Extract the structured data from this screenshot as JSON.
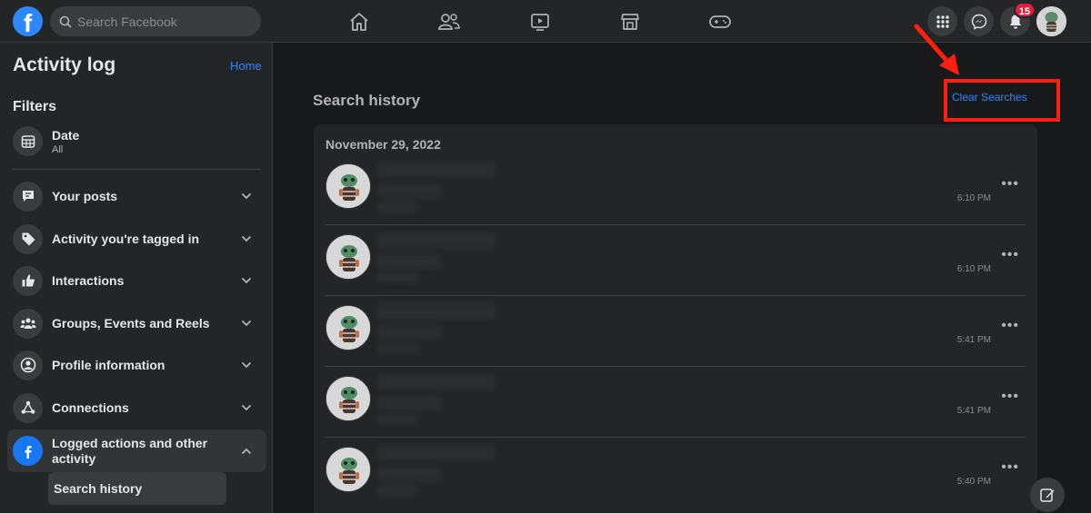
{
  "header": {
    "search_placeholder": "Search Facebook",
    "notification_count": "15"
  },
  "sidebar": {
    "title": "Activity log",
    "home_link": "Home",
    "filters_heading": "Filters",
    "date_filter": {
      "label": "Date",
      "value": "All"
    },
    "items": [
      {
        "label": "Your posts"
      },
      {
        "label": "Activity you're tagged in"
      },
      {
        "label": "Interactions"
      },
      {
        "label": "Groups, Events and Reels"
      },
      {
        "label": "Profile information"
      },
      {
        "label": "Connections"
      },
      {
        "label": "Logged actions and other activity"
      }
    ],
    "sub_item": "Search history"
  },
  "main": {
    "title": "Search history",
    "clear_button": "Clear Searches",
    "date_heading": "November 29, 2022",
    "entries": [
      {
        "time": "6:10 PM"
      },
      {
        "time": "6:10 PM"
      },
      {
        "time": "5:41 PM"
      },
      {
        "time": "5:41 PM"
      },
      {
        "time": "5:40 PM"
      }
    ]
  },
  "colors": {
    "accent": "#2d88ff",
    "highlight": "#ff1f0f",
    "badge": "#e41e3f"
  }
}
